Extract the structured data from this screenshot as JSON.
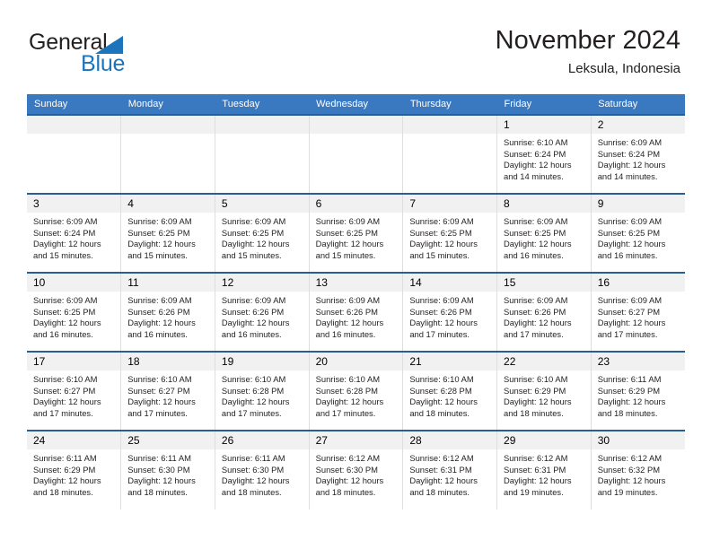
{
  "brand": {
    "name_part1": "General",
    "name_part2": "Blue"
  },
  "header": {
    "title": "November 2024",
    "subtitle": "Leksula, Indonesia"
  },
  "colors": {
    "header_blue": "#3a78bf",
    "row_rule": "#2b5c92",
    "daynum_band": "#f1f1f1",
    "brand_blue": "#1c75bc",
    "text": "#231f20"
  },
  "weekdays": [
    "Sunday",
    "Monday",
    "Tuesday",
    "Wednesday",
    "Thursday",
    "Friday",
    "Saturday"
  ],
  "labels": {
    "sunrise": "Sunrise:",
    "sunset": "Sunset:",
    "daylight": "Daylight:"
  },
  "weeks": [
    [
      {
        "day": "",
        "empty": true
      },
      {
        "day": "",
        "empty": true
      },
      {
        "day": "",
        "empty": true
      },
      {
        "day": "",
        "empty": true
      },
      {
        "day": "",
        "empty": true
      },
      {
        "day": "1",
        "sunrise": "Sunrise: 6:10 AM",
        "sunset": "Sunset: 6:24 PM",
        "daylight1": "Daylight: 12 hours",
        "daylight2": "and 14 minutes."
      },
      {
        "day": "2",
        "sunrise": "Sunrise: 6:09 AM",
        "sunset": "Sunset: 6:24 PM",
        "daylight1": "Daylight: 12 hours",
        "daylight2": "and 14 minutes."
      }
    ],
    [
      {
        "day": "3",
        "sunrise": "Sunrise: 6:09 AM",
        "sunset": "Sunset: 6:24 PM",
        "daylight1": "Daylight: 12 hours",
        "daylight2": "and 15 minutes."
      },
      {
        "day": "4",
        "sunrise": "Sunrise: 6:09 AM",
        "sunset": "Sunset: 6:25 PM",
        "daylight1": "Daylight: 12 hours",
        "daylight2": "and 15 minutes."
      },
      {
        "day": "5",
        "sunrise": "Sunrise: 6:09 AM",
        "sunset": "Sunset: 6:25 PM",
        "daylight1": "Daylight: 12 hours",
        "daylight2": "and 15 minutes."
      },
      {
        "day": "6",
        "sunrise": "Sunrise: 6:09 AM",
        "sunset": "Sunset: 6:25 PM",
        "daylight1": "Daylight: 12 hours",
        "daylight2": "and 15 minutes."
      },
      {
        "day": "7",
        "sunrise": "Sunrise: 6:09 AM",
        "sunset": "Sunset: 6:25 PM",
        "daylight1": "Daylight: 12 hours",
        "daylight2": "and 15 minutes."
      },
      {
        "day": "8",
        "sunrise": "Sunrise: 6:09 AM",
        "sunset": "Sunset: 6:25 PM",
        "daylight1": "Daylight: 12 hours",
        "daylight2": "and 16 minutes."
      },
      {
        "day": "9",
        "sunrise": "Sunrise: 6:09 AM",
        "sunset": "Sunset: 6:25 PM",
        "daylight1": "Daylight: 12 hours",
        "daylight2": "and 16 minutes."
      }
    ],
    [
      {
        "day": "10",
        "sunrise": "Sunrise: 6:09 AM",
        "sunset": "Sunset: 6:25 PM",
        "daylight1": "Daylight: 12 hours",
        "daylight2": "and 16 minutes."
      },
      {
        "day": "11",
        "sunrise": "Sunrise: 6:09 AM",
        "sunset": "Sunset: 6:26 PM",
        "daylight1": "Daylight: 12 hours",
        "daylight2": "and 16 minutes."
      },
      {
        "day": "12",
        "sunrise": "Sunrise: 6:09 AM",
        "sunset": "Sunset: 6:26 PM",
        "daylight1": "Daylight: 12 hours",
        "daylight2": "and 16 minutes."
      },
      {
        "day": "13",
        "sunrise": "Sunrise: 6:09 AM",
        "sunset": "Sunset: 6:26 PM",
        "daylight1": "Daylight: 12 hours",
        "daylight2": "and 16 minutes."
      },
      {
        "day": "14",
        "sunrise": "Sunrise: 6:09 AM",
        "sunset": "Sunset: 6:26 PM",
        "daylight1": "Daylight: 12 hours",
        "daylight2": "and 17 minutes."
      },
      {
        "day": "15",
        "sunrise": "Sunrise: 6:09 AM",
        "sunset": "Sunset: 6:26 PM",
        "daylight1": "Daylight: 12 hours",
        "daylight2": "and 17 minutes."
      },
      {
        "day": "16",
        "sunrise": "Sunrise: 6:09 AM",
        "sunset": "Sunset: 6:27 PM",
        "daylight1": "Daylight: 12 hours",
        "daylight2": "and 17 minutes."
      }
    ],
    [
      {
        "day": "17",
        "sunrise": "Sunrise: 6:10 AM",
        "sunset": "Sunset: 6:27 PM",
        "daylight1": "Daylight: 12 hours",
        "daylight2": "and 17 minutes."
      },
      {
        "day": "18",
        "sunrise": "Sunrise: 6:10 AM",
        "sunset": "Sunset: 6:27 PM",
        "daylight1": "Daylight: 12 hours",
        "daylight2": "and 17 minutes."
      },
      {
        "day": "19",
        "sunrise": "Sunrise: 6:10 AM",
        "sunset": "Sunset: 6:28 PM",
        "daylight1": "Daylight: 12 hours",
        "daylight2": "and 17 minutes."
      },
      {
        "day": "20",
        "sunrise": "Sunrise: 6:10 AM",
        "sunset": "Sunset: 6:28 PM",
        "daylight1": "Daylight: 12 hours",
        "daylight2": "and 17 minutes."
      },
      {
        "day": "21",
        "sunrise": "Sunrise: 6:10 AM",
        "sunset": "Sunset: 6:28 PM",
        "daylight1": "Daylight: 12 hours",
        "daylight2": "and 18 minutes."
      },
      {
        "day": "22",
        "sunrise": "Sunrise: 6:10 AM",
        "sunset": "Sunset: 6:29 PM",
        "daylight1": "Daylight: 12 hours",
        "daylight2": "and 18 minutes."
      },
      {
        "day": "23",
        "sunrise": "Sunrise: 6:11 AM",
        "sunset": "Sunset: 6:29 PM",
        "daylight1": "Daylight: 12 hours",
        "daylight2": "and 18 minutes."
      }
    ],
    [
      {
        "day": "24",
        "sunrise": "Sunrise: 6:11 AM",
        "sunset": "Sunset: 6:29 PM",
        "daylight1": "Daylight: 12 hours",
        "daylight2": "and 18 minutes."
      },
      {
        "day": "25",
        "sunrise": "Sunrise: 6:11 AM",
        "sunset": "Sunset: 6:30 PM",
        "daylight1": "Daylight: 12 hours",
        "daylight2": "and 18 minutes."
      },
      {
        "day": "26",
        "sunrise": "Sunrise: 6:11 AM",
        "sunset": "Sunset: 6:30 PM",
        "daylight1": "Daylight: 12 hours",
        "daylight2": "and 18 minutes."
      },
      {
        "day": "27",
        "sunrise": "Sunrise: 6:12 AM",
        "sunset": "Sunset: 6:30 PM",
        "daylight1": "Daylight: 12 hours",
        "daylight2": "and 18 minutes."
      },
      {
        "day": "28",
        "sunrise": "Sunrise: 6:12 AM",
        "sunset": "Sunset: 6:31 PM",
        "daylight1": "Daylight: 12 hours",
        "daylight2": "and 18 minutes."
      },
      {
        "day": "29",
        "sunrise": "Sunrise: 6:12 AM",
        "sunset": "Sunset: 6:31 PM",
        "daylight1": "Daylight: 12 hours",
        "daylight2": "and 19 minutes."
      },
      {
        "day": "30",
        "sunrise": "Sunrise: 6:12 AM",
        "sunset": "Sunset: 6:32 PM",
        "daylight1": "Daylight: 12 hours",
        "daylight2": "and 19 minutes."
      }
    ]
  ]
}
